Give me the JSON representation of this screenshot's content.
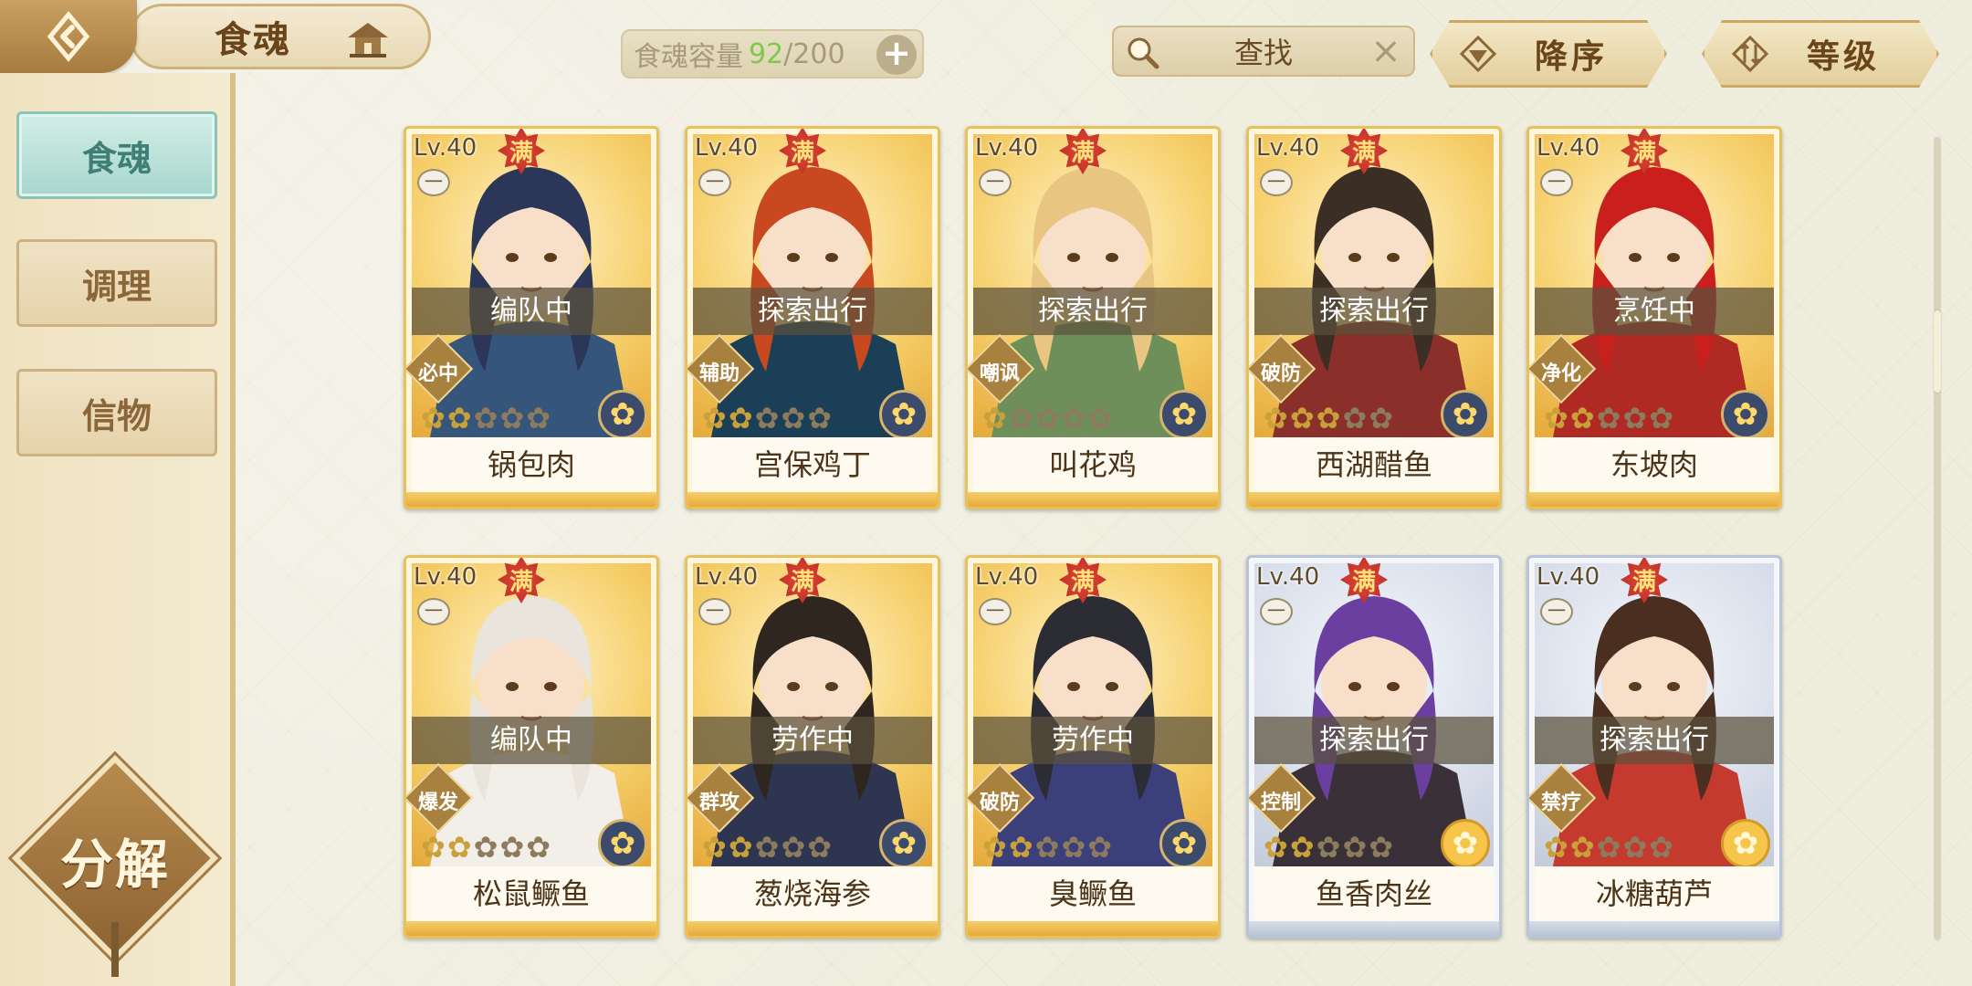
{
  "header": {
    "title": "食魂",
    "capacity_label": "食魂容量",
    "capacity_current": "92",
    "capacity_max": "/200",
    "add_symbol": "+",
    "search_label": "查找",
    "clear_symbol": "×",
    "sort_order_label": "降序",
    "sort_field_label": "等级"
  },
  "sidebar": {
    "items": [
      {
        "label": "食魂",
        "active": true
      },
      {
        "label": "调理",
        "active": false
      },
      {
        "label": "信物",
        "active": false
      }
    ],
    "decompose_label": "分解"
  },
  "colors": {
    "accent_green": "#7fc84a",
    "card_gold": "#e8c15c",
    "card_blue": "#b7c4d7",
    "max_badge": "#d23a2e"
  },
  "cards": [
    {
      "level": "Lv.40",
      "max": "满",
      "dash": "一",
      "status": "编队中",
      "role": "必中",
      "stars_on": 2,
      "name": "锅包肉",
      "frame": "gold"
    },
    {
      "level": "Lv.40",
      "max": "满",
      "dash": "一",
      "status": "探索出行",
      "role": "辅助",
      "stars_on": 2,
      "name": "宫保鸡丁",
      "frame": "gold"
    },
    {
      "level": "Lv.40",
      "max": "满",
      "dash": "一",
      "status": "探索出行",
      "role": "嘲讽",
      "stars_on": 1,
      "name": "叫花鸡",
      "frame": "gold"
    },
    {
      "level": "Lv.40",
      "max": "满",
      "dash": "一",
      "status": "探索出行",
      "role": "破防",
      "stars_on": 3,
      "name": "西湖醋鱼",
      "frame": "gold"
    },
    {
      "level": "Lv.40",
      "max": "满",
      "dash": "一",
      "status": "烹饪中",
      "role": "净化",
      "stars_on": 2,
      "name": "东坡肉",
      "frame": "gold"
    },
    {
      "level": "Lv.40",
      "max": "满",
      "dash": "一",
      "status": "编队中",
      "role": "爆发",
      "stars_on": 2,
      "name": "松鼠鳜鱼",
      "frame": "gold"
    },
    {
      "level": "Lv.40",
      "max": "满",
      "dash": "一",
      "status": "劳作中",
      "role": "群攻",
      "stars_on": 2,
      "name": "葱烧海参",
      "frame": "gold"
    },
    {
      "level": "Lv.40",
      "max": "满",
      "dash": "一",
      "status": "劳作中",
      "role": "破防",
      "stars_on": 2,
      "name": "臭鳜鱼",
      "frame": "gold"
    },
    {
      "level": "Lv.40",
      "max": "满",
      "dash": "一",
      "status": "探索出行",
      "role": "控制",
      "stars_on": 2,
      "name": "鱼香肉丝",
      "frame": "blue"
    },
    {
      "level": "Lv.40",
      "max": "满",
      "dash": "一",
      "status": "探索出行",
      "role": "禁疗",
      "stars_on": 2,
      "name": "冰糖葫芦",
      "frame": "blue"
    }
  ]
}
